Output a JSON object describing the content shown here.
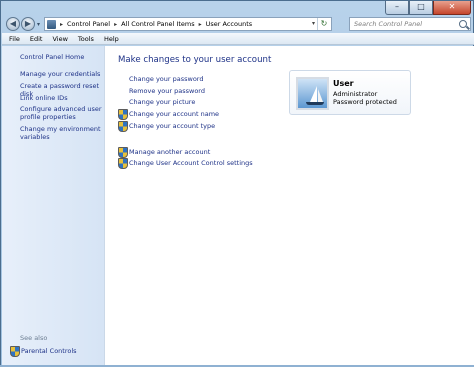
{
  "window": {
    "minimize_glyph": "–",
    "maximize_glyph": "□",
    "close_glyph": "✕"
  },
  "address": {
    "crumbs": [
      "Control Panel",
      "All Control Panel Items",
      "User Accounts"
    ],
    "separator": "▸",
    "search_placeholder": "Search Control Panel"
  },
  "menu": [
    "File",
    "Edit",
    "View",
    "Tools",
    "Help"
  ],
  "left_pane": {
    "home": "Control Panel Home",
    "links": [
      "Manage your credentials",
      "Create a password reset disk",
      "Link online IDs",
      "Configure advanced user profile properties",
      "Change my environment variables"
    ],
    "see_also": "See also",
    "parental": "Parental Controls"
  },
  "main": {
    "heading": "Make changes to your user account",
    "tasks": [
      "Change your password",
      "Remove your password",
      "Change your picture",
      "Change your account name",
      "Change your account type"
    ],
    "other_tasks": [
      "Manage another account",
      "Change User Account Control settings"
    ]
  },
  "user": {
    "name": "User",
    "role": "Administrator",
    "status": "Password protected"
  }
}
